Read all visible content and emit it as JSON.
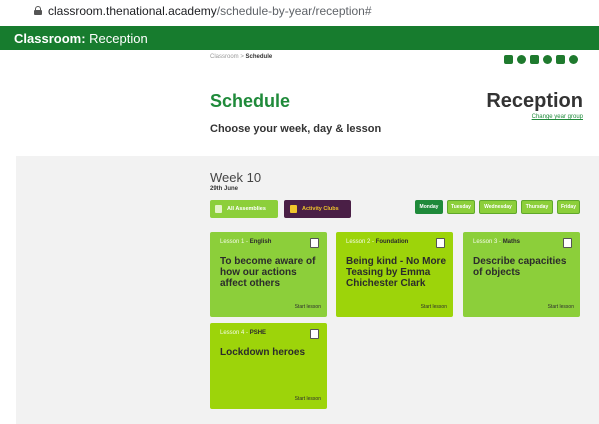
{
  "browser": {
    "url_host": "classroom.thenational.academy",
    "url_path": "/schedule-by-year/reception#"
  },
  "topbar": {
    "brand_bold": "Classroom:",
    "brand_rest": " Reception"
  },
  "header": {
    "breadcrumb_root": "Classroom",
    "breadcrumb_sep": " > ",
    "breadcrumb_current": "Schedule",
    "title": "Schedule",
    "subtitle": "Choose your week, day & lesson",
    "year": "Reception",
    "change_year": "Change year group",
    "social_icons": [
      "facebook-icon",
      "pinterest-icon",
      "twitter-icon",
      "instagram-icon",
      "youtube-icon",
      "website-icon"
    ]
  },
  "schedule": {
    "week": "Week 10",
    "date": "29th June",
    "all_assemblies": "All Assemblies",
    "activity_clubs": "Activity Clubs",
    "days": [
      {
        "label": "Monday",
        "active": true
      },
      {
        "label": "Tuesday",
        "active": false
      },
      {
        "label": "Wednesday",
        "active": false
      },
      {
        "label": "Thursday",
        "active": false
      },
      {
        "label": "Friday",
        "active": false
      }
    ],
    "lessons": [
      {
        "number": "Lesson 1 - ",
        "subject": "English",
        "title": "To become aware of how our actions affect others",
        "cta": "Start lesson",
        "icon": "book-icon"
      },
      {
        "number": "Lesson 2 - ",
        "subject": "Foundation",
        "title": "Being kind - No More Teasing by Emma Chichester Clark",
        "cta": "Start lesson",
        "icon": "microscope-icon"
      },
      {
        "number": "Lesson 3 - ",
        "subject": "Maths",
        "title": "Describe capacities of objects",
        "cta": "Start lesson",
        "icon": "ruler-icon"
      },
      {
        "number": "Lesson 4 - ",
        "subject": "PSHE",
        "title": "Lockdown heroes",
        "cta": "Start lesson",
        "icon": "chat-icon"
      }
    ]
  },
  "colors": {
    "brand_green": "#177c2e",
    "title_green": "#1f8a3a",
    "card_green": "#8ccf3a",
    "card_bright": "#9dd40a",
    "clubs_purple": "#4a1f46",
    "clubs_yellow": "#f0c52b"
  }
}
